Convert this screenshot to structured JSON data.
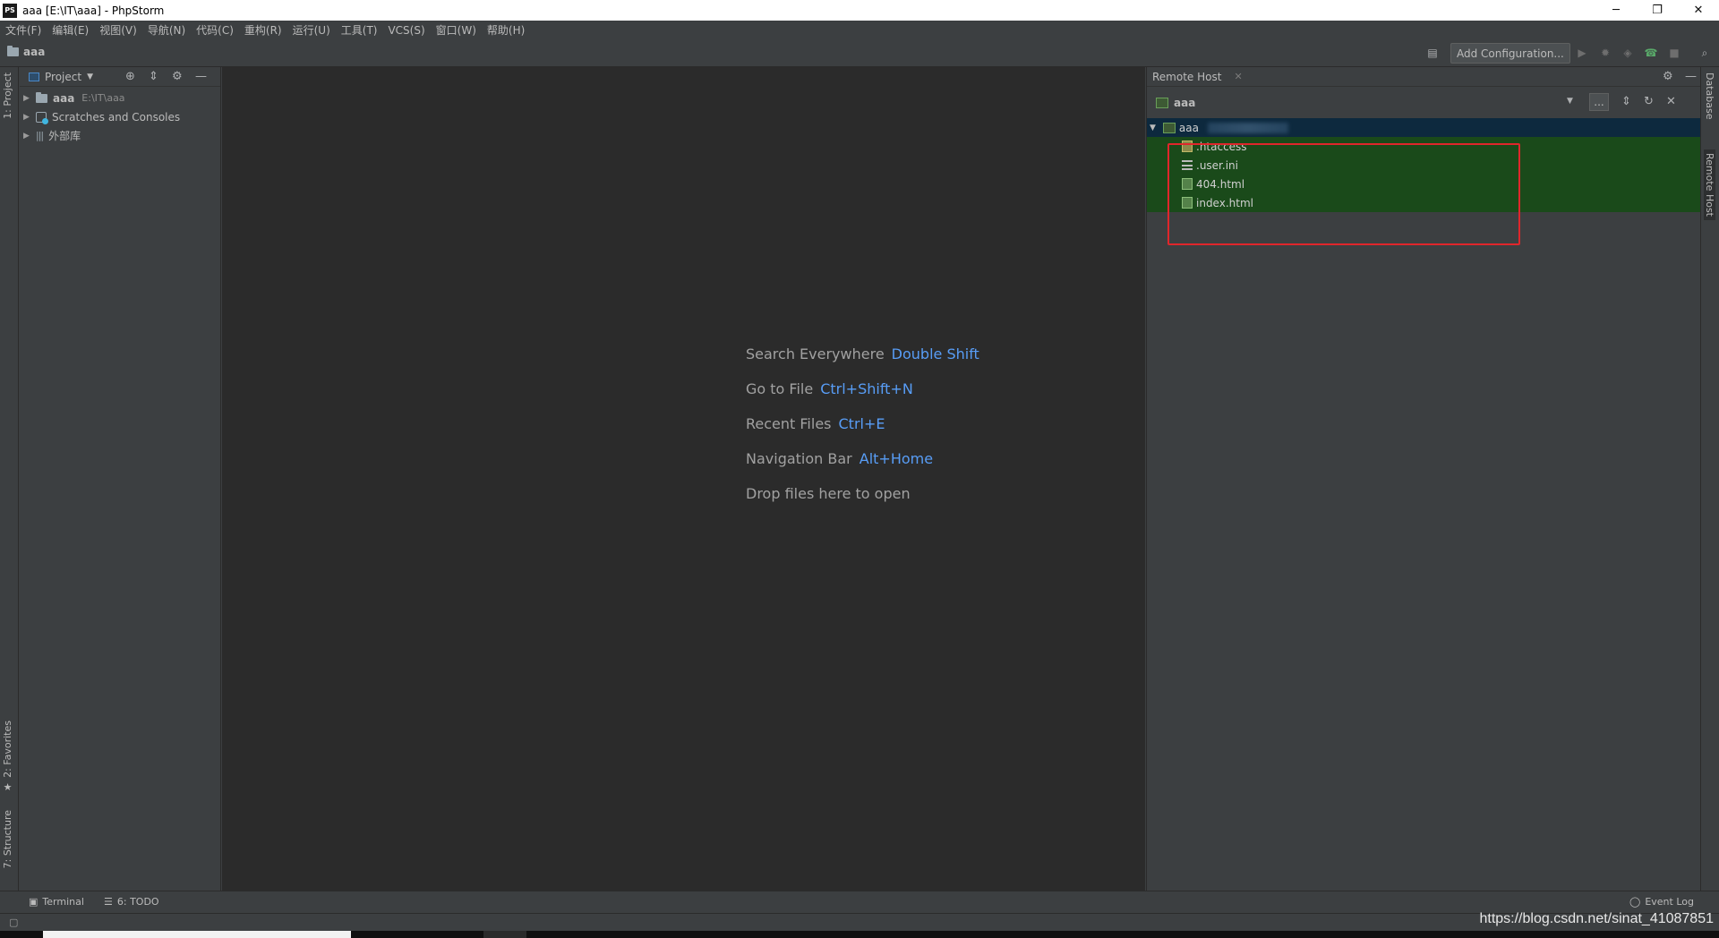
{
  "window": {
    "app_logo": "PS",
    "title": "aaa [E:\\IT\\aaa] - PhpStorm",
    "minimize": "─",
    "maximize": "❐",
    "close": "✕"
  },
  "menu": [
    "文件(F)",
    "编辑(E)",
    "视图(V)",
    "导航(N)",
    "代码(C)",
    "重构(R)",
    "运行(U)",
    "工具(T)",
    "VCS(S)",
    "窗口(W)",
    "帮助(H)"
  ],
  "navbar": {
    "breadcrumb": "aaa",
    "add_config_label": "Add Configuration..."
  },
  "left_stripe": {
    "project_tab": "1: Project",
    "favorites_tab": "2: Favorites",
    "structure_tab": "7: Structure"
  },
  "right_stripe": {
    "database_tab": "Database",
    "remote_host_tab": "Remote Host"
  },
  "project_panel": {
    "title": "Project",
    "tree": [
      {
        "label": "aaa",
        "path": "E:\\IT\\aaa"
      },
      {
        "label": "Scratches and Consoles"
      },
      {
        "label": "外部库"
      }
    ]
  },
  "editor": {
    "hints": [
      {
        "text": "Search Everywhere",
        "key": "Double Shift"
      },
      {
        "text": "Go to File",
        "key": "Ctrl+Shift+N"
      },
      {
        "text": "Recent Files",
        "key": "Ctrl+E"
      },
      {
        "text": "Navigation Bar",
        "key": "Alt+Home"
      },
      {
        "text": "Drop files here to open",
        "key": ""
      }
    ]
  },
  "remote_panel": {
    "tab_title": "Remote Host",
    "host_name": "aaa",
    "root_label": "aaa",
    "more_button": "...",
    "files": [
      ".htaccess",
      ".user.ini",
      "404.html",
      "index.html"
    ]
  },
  "bottom_tools": {
    "terminal": "Terminal",
    "todo": "6: TODO",
    "event_log": "Event Log"
  },
  "watermark": "https://blog.csdn.net/sinat_41087851",
  "colors": {
    "accent_key": "#589df6",
    "highlight_red": "#e0262b",
    "file_group_bg": "#1a4a1a"
  }
}
